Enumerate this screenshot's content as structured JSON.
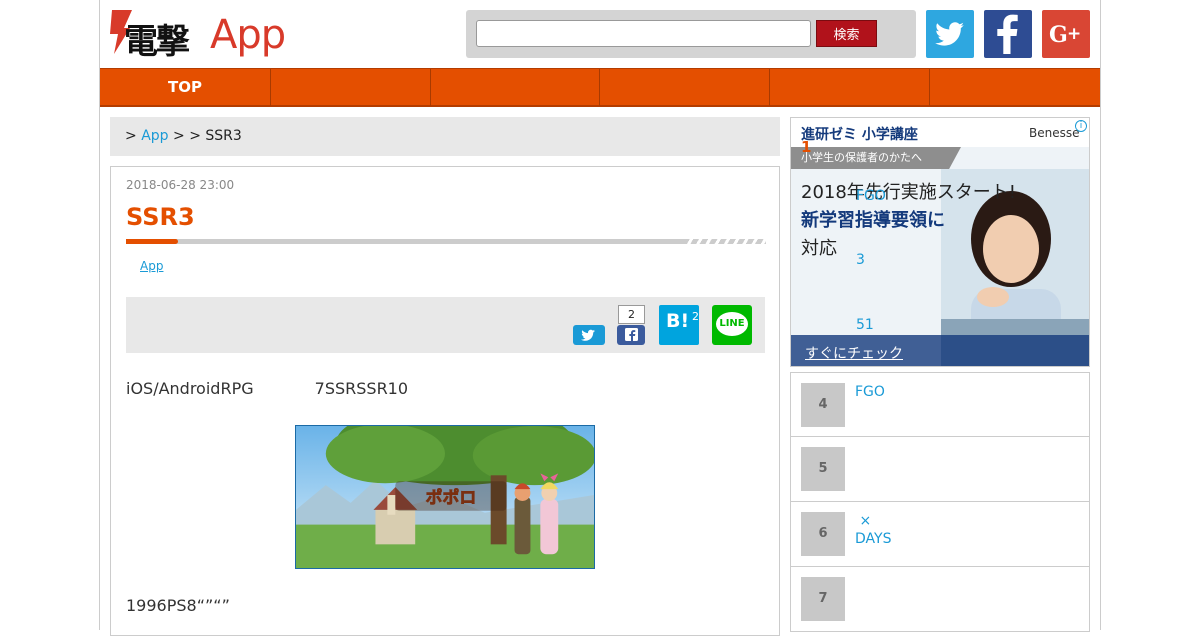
{
  "header": {
    "logo_kanji": "電撃",
    "logo_app": "App",
    "search": {
      "value": "",
      "button_label": "検索"
    },
    "social": [
      "twitter",
      "facebook",
      "google-plus"
    ]
  },
  "nav": {
    "items": [
      "TOP",
      "",
      "",
      "",
      "",
      ""
    ]
  },
  "breadcrumb": {
    "sep1": ">",
    "link": "App",
    "sep2": ">",
    "sep3": ">",
    "current": "SSR3"
  },
  "article": {
    "date": "2018-06-28 23:00",
    "title": "SSR3",
    "category": "App",
    "share": {
      "fb_count": "2",
      "hatena_label": "B!",
      "hatena_count": "2",
      "line_label": "LINE"
    },
    "paragraph1": "iOS/AndroidRPG            7SSRSSR10",
    "paragraph2": "1996PS8“”“”"
  },
  "sidebar": {
    "ad": {
      "brand_left": "進研ゼミ 小学講座",
      "brand_right": "Benesse",
      "info_icon": "i",
      "tag": "小学生の保護者のかたへ",
      "line1": "2018年先行実施スタート!",
      "line2": "新学習指導要領に",
      "line3": "対応",
      "cta": "すぐにチェック"
    },
    "rank1_num": "1",
    "overlay_links": [
      "FGO",
      "3",
      "51"
    ],
    "ranking": [
      {
        "num": "4",
        "text": "FGO"
      },
      {
        "num": "5",
        "text": ""
      },
      {
        "num": "6",
        "text": " ×\nDAYS"
      },
      {
        "num": "7",
        "text": ""
      }
    ]
  }
}
